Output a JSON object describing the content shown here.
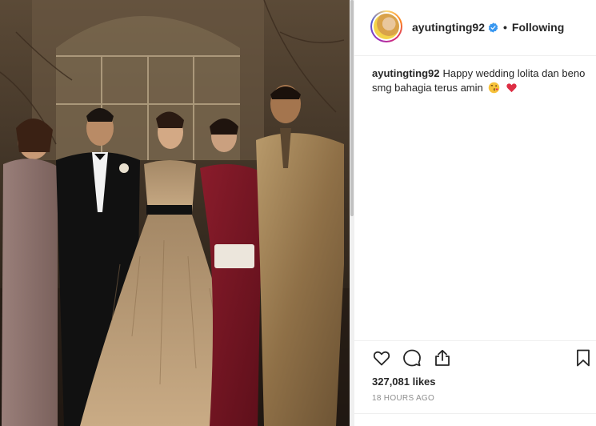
{
  "post": {
    "username": "ayutingting92",
    "follow_status": "Following",
    "separator": "•",
    "caption_user": "ayutingting92",
    "caption_text": "Happy wedding lolita dan beno smg bahagia terus amin",
    "caption_emojis": [
      "kissing-face-emoji",
      "red-heart-emoji"
    ],
    "likes": "327,081 likes",
    "time_ago": "18 HOURS AGO"
  },
  "icons": {
    "verified": "verified-badge-icon",
    "like": "heart-icon",
    "comment": "comment-bubble-icon",
    "share": "share-arrow-icon",
    "save": "bookmark-icon"
  },
  "colors": {
    "verified_blue": "#3897f0",
    "text": "#262626",
    "muted": "#8e8e8e",
    "border": "#efefef"
  }
}
